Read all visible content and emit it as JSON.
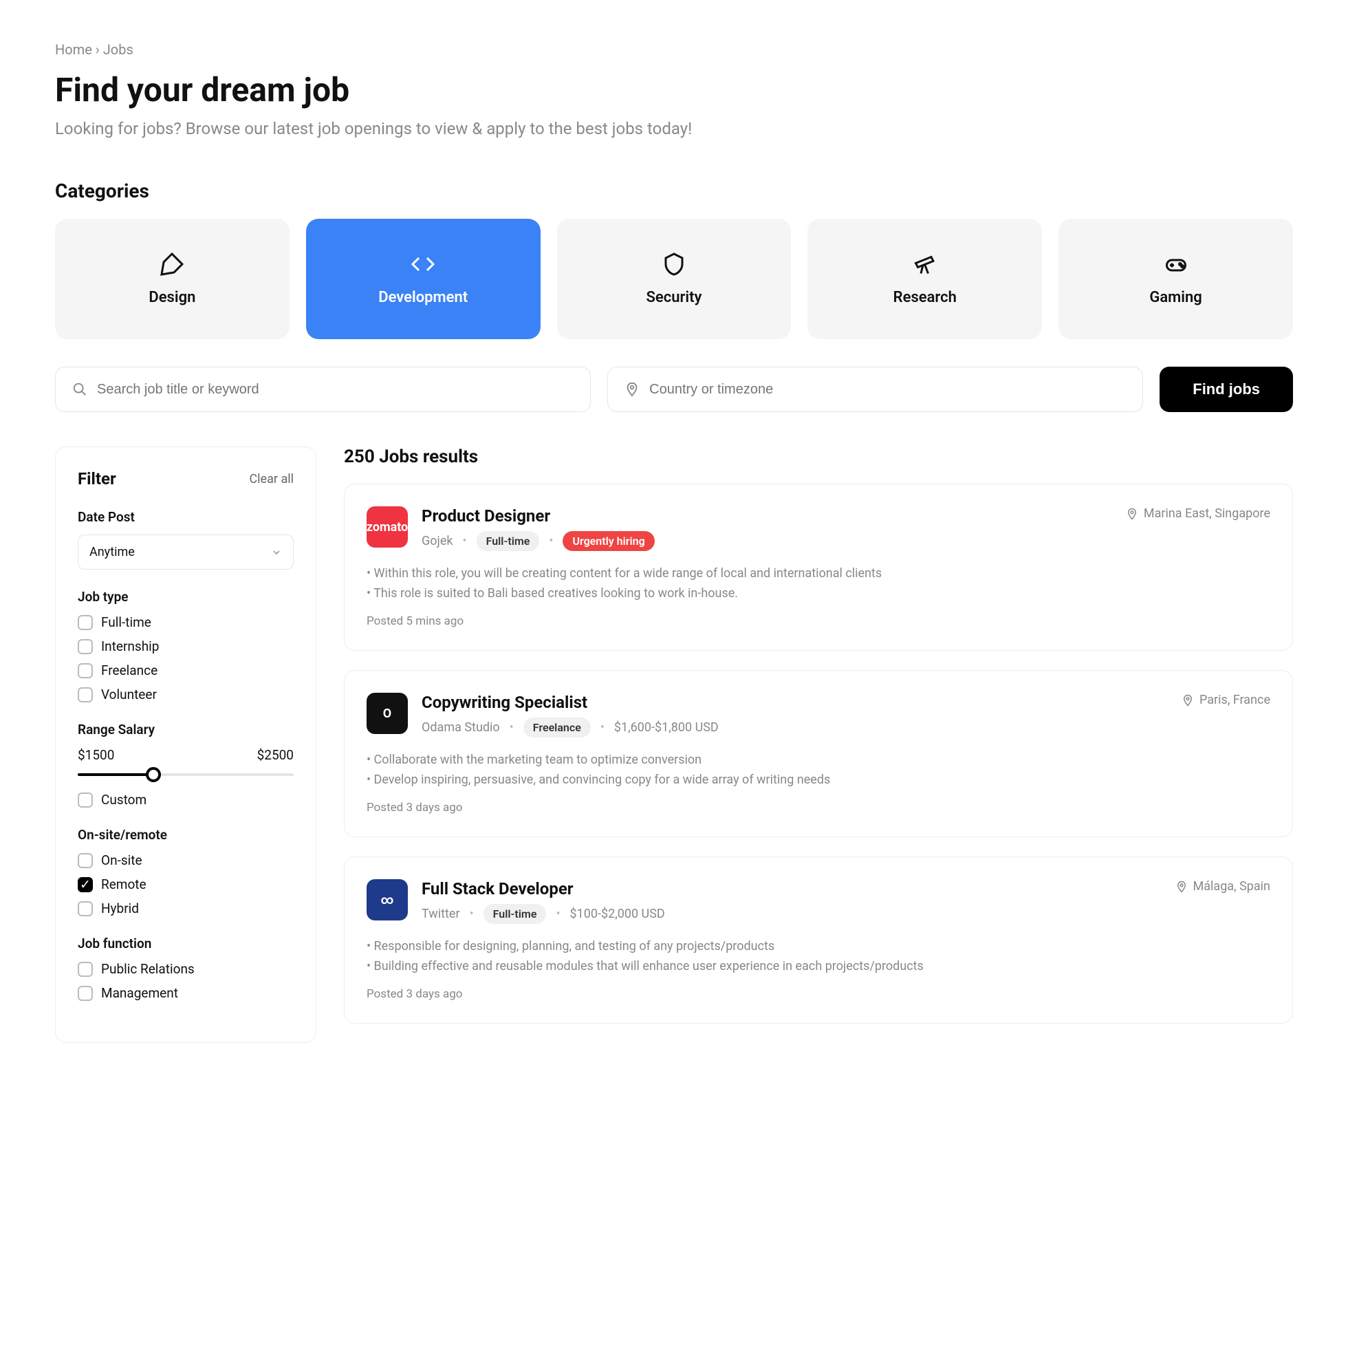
{
  "breadcrumb": {
    "home": "Home",
    "current": "Jobs"
  },
  "title": "Find your dream job",
  "subtitle": "Looking for jobs? Browse our latest job openings to view & apply to the best jobs today!",
  "categories_label": "Categories",
  "categories": [
    {
      "label": "Design"
    },
    {
      "label": "Development"
    },
    {
      "label": "Security"
    },
    {
      "label": "Research"
    },
    {
      "label": "Gaming"
    }
  ],
  "search": {
    "keyword_placeholder": "Search job title or keyword",
    "location_placeholder": "Country or timezone",
    "button": "Find jobs"
  },
  "filter": {
    "title": "Filter",
    "clear": "Clear all",
    "date_post_label": "Date Post",
    "date_post_value": "Anytime",
    "job_type_label": "Job type",
    "job_types": [
      "Full-time",
      "Internship",
      "Freelance",
      "Volunteer"
    ],
    "range_label": "Range Salary",
    "range_min": "$1500",
    "range_max": "$2500",
    "range_custom": "Custom",
    "onsite_label": "On-site/remote",
    "onsite_options": [
      {
        "label": "On-site",
        "checked": false
      },
      {
        "label": "Remote",
        "checked": true
      },
      {
        "label": "Hybrid",
        "checked": false
      }
    ],
    "job_function_label": "Job function",
    "job_functions": [
      "Public Relations",
      "Management"
    ]
  },
  "results": {
    "title": "250 Jobs results",
    "jobs": [
      {
        "logo_text": "zomato",
        "logo_bg": "#ef3340",
        "title": "Product Designer",
        "company": "Gojek",
        "badge": "Full-time",
        "extra_badge": "Urgently hiring",
        "salary": "",
        "location": "Marina East, Singapore",
        "bullets": [
          "Within this role, you will be creating content for a wide range of local and international clients",
          "This role is suited to Bali based creatives looking to work in-house."
        ],
        "posted": "Posted 5 mins ago"
      },
      {
        "logo_text": "O",
        "logo_bg": "#111111",
        "title": "Copywriting Specialist",
        "company": "Odama Studio",
        "badge": "Freelance",
        "extra_badge": "",
        "salary": "$1,600-$1,800 USD",
        "location": "Paris, France",
        "bullets": [
          "Collaborate with the marketing team to optimize conversion",
          "Develop inspiring, persuasive, and convincing copy for a wide array of writing needs"
        ],
        "posted": "Posted 3 days ago"
      },
      {
        "logo_text": "∞",
        "logo_bg": "#1e3a8a",
        "title": "Full Stack Developer",
        "company": "Twitter",
        "badge": "Full-time",
        "extra_badge": "",
        "salary": "$100-$2,000 USD",
        "location": "Málaga, Spain",
        "bullets": [
          "Responsible for designing, planning, and testing of any projects/products",
          "Building effective and reusable modules that will enhance user experience in each projects/products"
        ],
        "posted": "Posted 3 days ago"
      }
    ]
  }
}
